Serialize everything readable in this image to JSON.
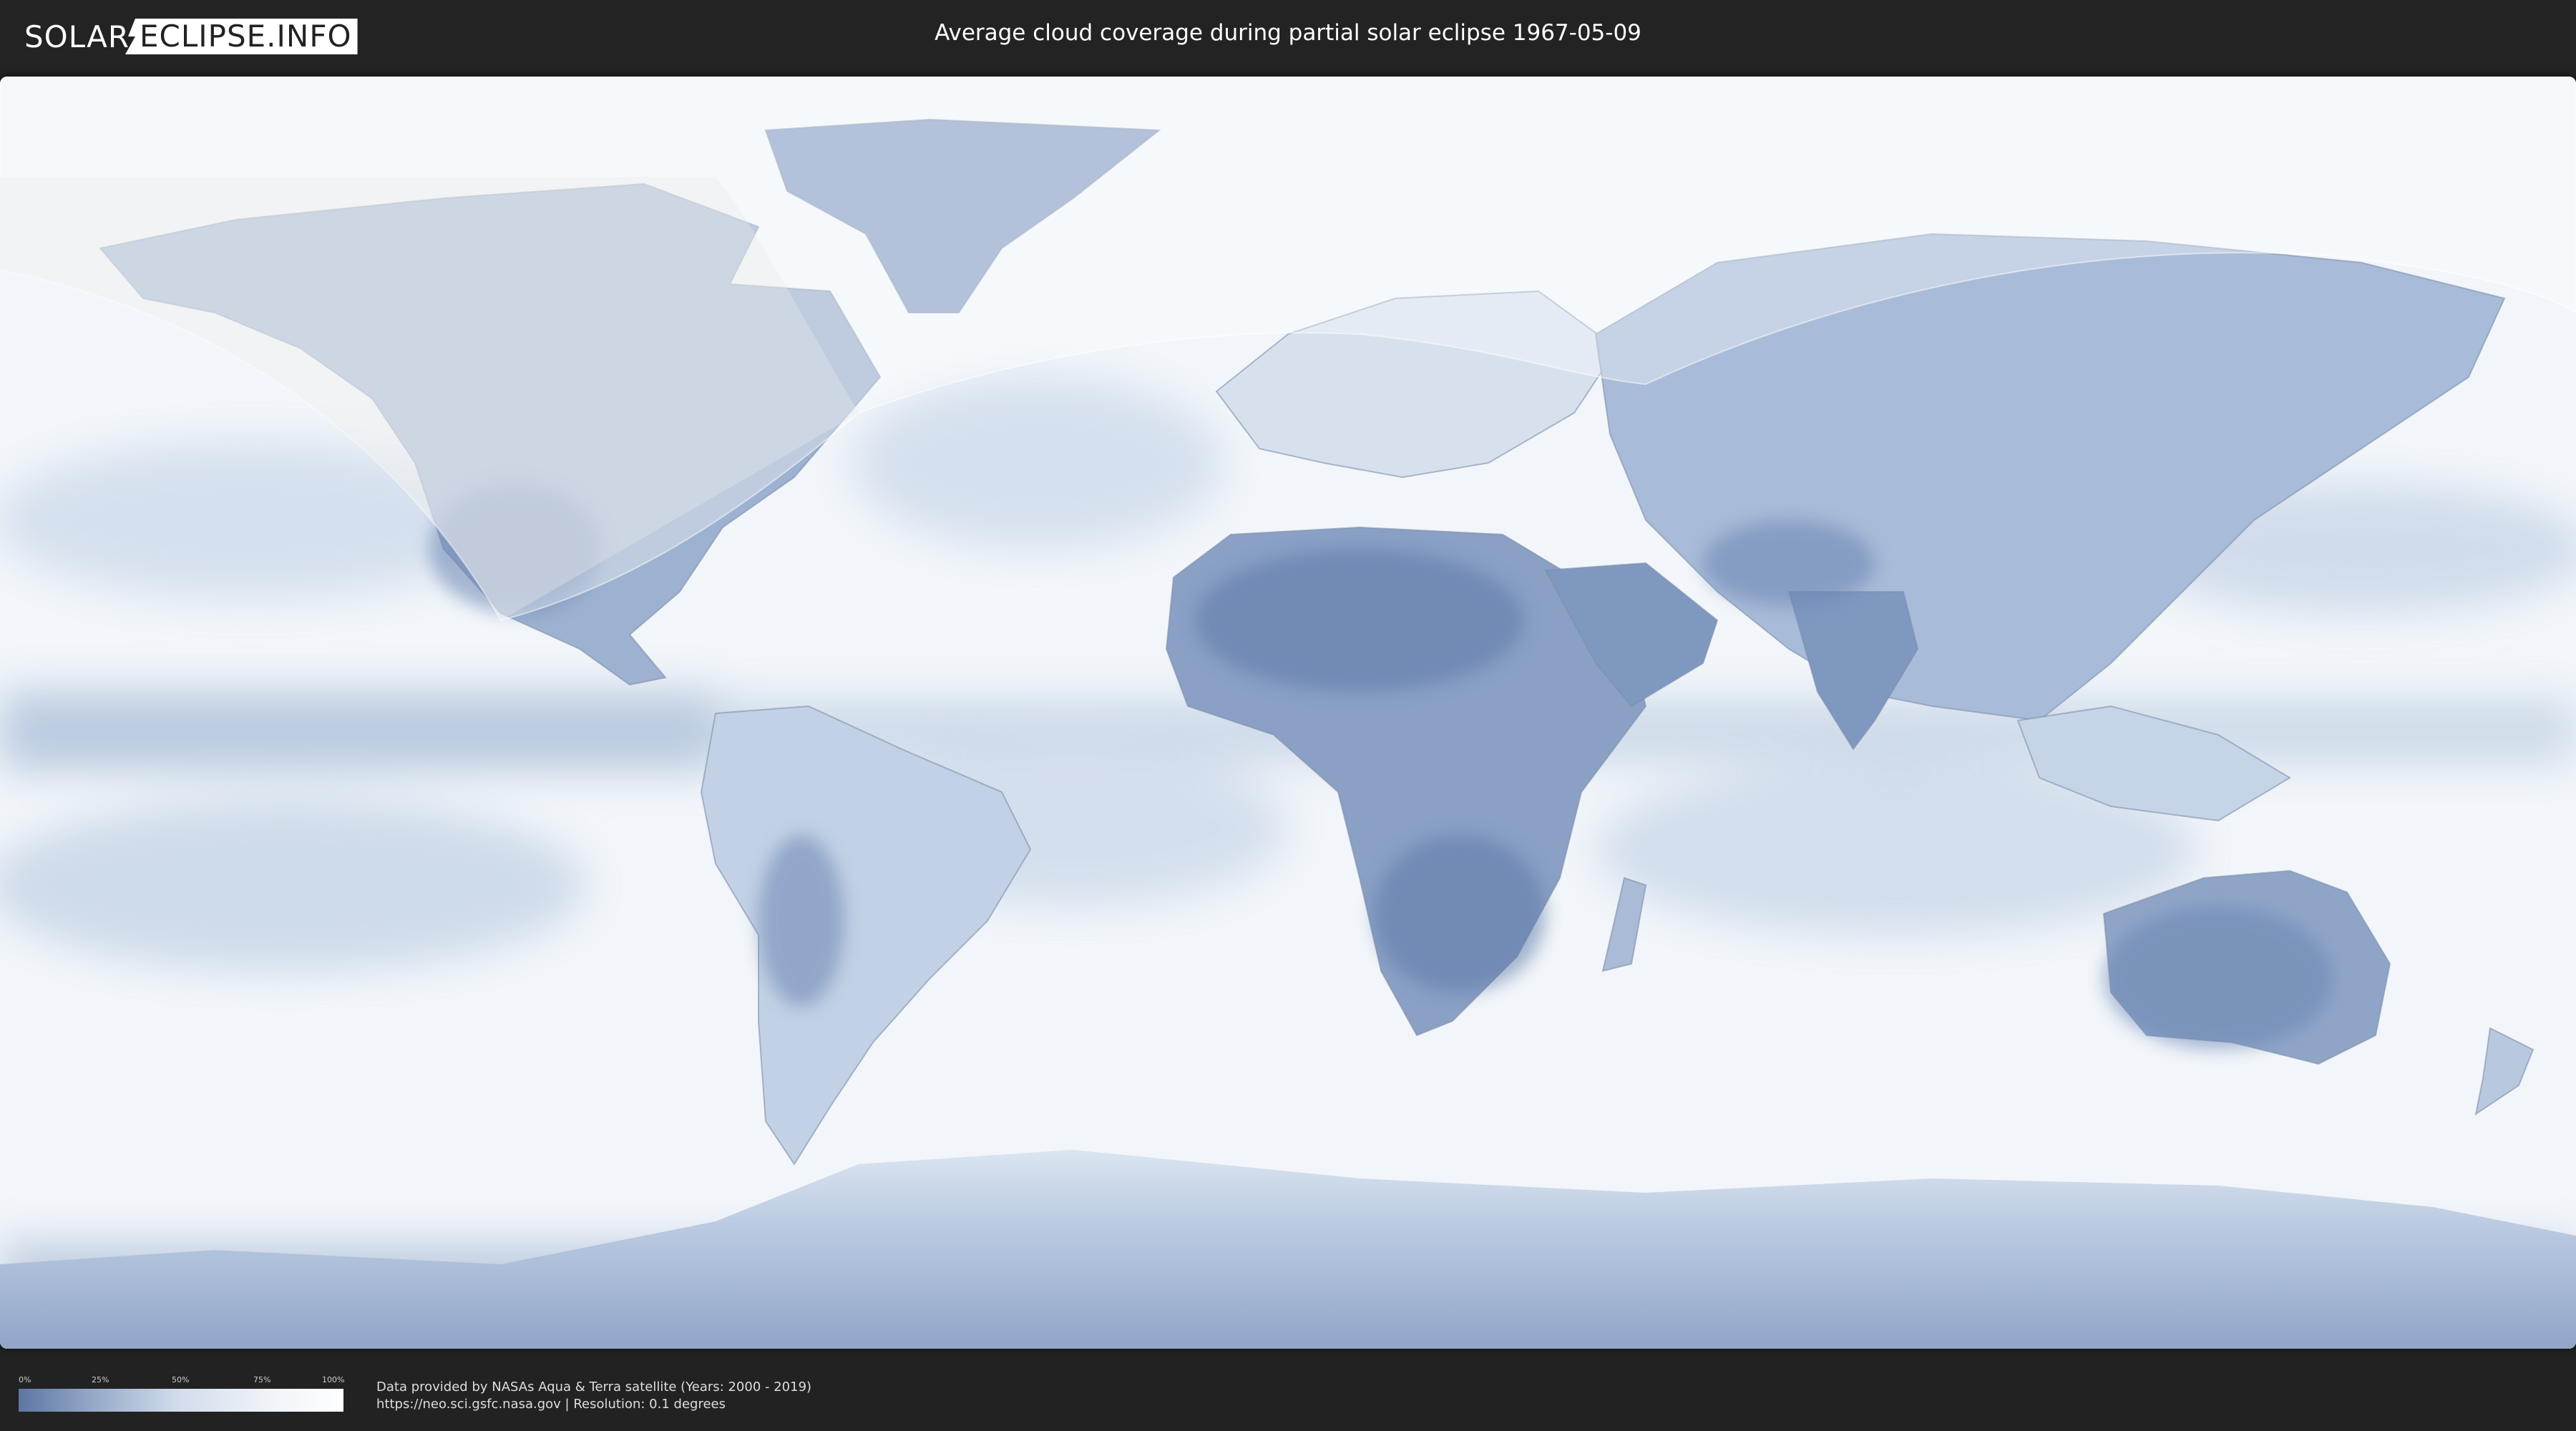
{
  "header": {
    "logo_part1": "SOLAR",
    "logo_part2": "ECLIPSE.INFO",
    "title": "Average cloud coverage during partial solar eclipse 1967-05-09"
  },
  "legend": {
    "ticks": [
      "0%",
      "25%",
      "50%",
      "75%",
      "100%"
    ],
    "colors": {
      "low": "#5d76a3",
      "mid": "#d3dded",
      "high": "#ffffff"
    }
  },
  "credits": {
    "line1": "Data provided by NASAs Aqua & Terra satellite (Years: 2000 - 2019)",
    "line2": "https://neo.sci.gsfc.nasa.gov | Resolution: 0.1 degrees"
  },
  "map": {
    "projection": "equirectangular",
    "ocean_color": "#e9eff6",
    "land_cloud_low_color": "#6a86b4",
    "eclipse_visibility_shading": "lighter overlay over Europe, Africa, Asia, North America (northern hemisphere)"
  }
}
